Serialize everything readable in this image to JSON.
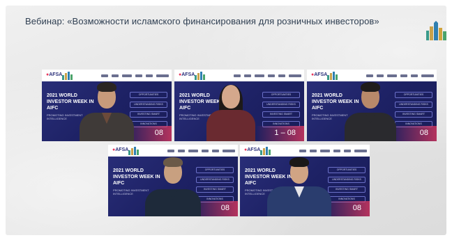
{
  "webinar": {
    "title": "Вебинар: «Возможности исламского финансирования для розничных инвесторов»"
  },
  "tiles": [
    {
      "org": "AFSA",
      "headline": "2021 WORLD INVESTOR WEEK IN AIFC",
      "subline": "PROMOTING INVESTMENT INTELLIGENCE",
      "date": "08",
      "tags": [
        "OPPORTUNITIES",
        "UNDERSTANDING RISKS",
        "INVESTING SMART",
        "INNOVATIONS"
      ]
    },
    {
      "org": "AFSA",
      "headline": "2021 WORLD INVESTOR WEEK IN AIFC",
      "subline": "PROMOTING INVESTMENT INTELLIGENCE",
      "date": "1 – 08",
      "tags": [
        "OPPORTUNITIES",
        "UNDERSTANDING RISKS",
        "INVESTING SMART",
        "INNOVATIONS"
      ]
    },
    {
      "org": "AFSA",
      "headline": "2021 WORLD INVESTOR WEEK IN AIFC",
      "subline": "PROMOTING INVESTMENT INTELLIGENCE",
      "date": "08",
      "tags": [
        "OPPORTUNITIES",
        "UNDERSTANDING RISKS",
        "INVESTING SMART",
        "INNOVATIONS"
      ]
    },
    {
      "org": "AFSA",
      "headline": "2021 WORLD INVESTOR WEEK IN AIFC",
      "subline": "PROMOTING INVESTMENT INTELLIGENCE",
      "date": "08",
      "tags": [
        "OPPORTUNITIES",
        "UNDERSTANDING RISKS",
        "INVESTING SMART",
        "INNOVATIONS"
      ]
    },
    {
      "org": "AFSA",
      "headline": "2021 WORLD INVESTOR WEEK IN AIFC",
      "subline": "PROMOTING INVESTMENT INTELLIGENCE",
      "date": "08",
      "tags": [
        "OPPORTUNITIES",
        "UNDERSTANDING RISKS",
        "INVESTING SMART",
        "INNOVATIONS"
      ]
    }
  ],
  "colors": {
    "background": "#e6e6e6",
    "tile_navy": "#1d2164",
    "accent_pink": "#e83a5f",
    "title_text": "#2f3f52"
  },
  "icons": [
    "building-logo-icon"
  ]
}
